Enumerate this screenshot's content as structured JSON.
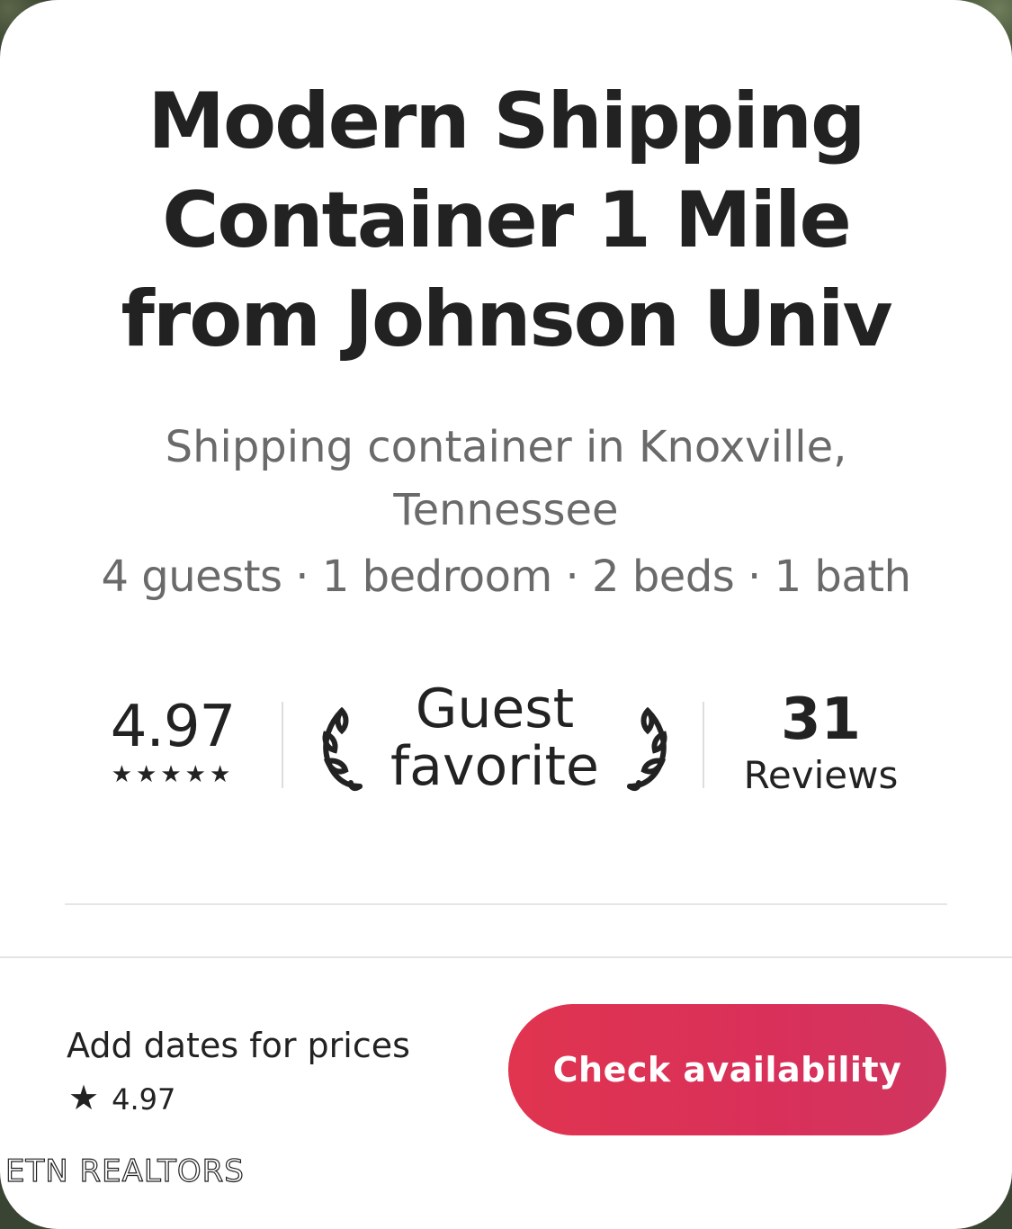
{
  "listing": {
    "title": "Modern Shipping Container 1 Mile from Johnson Univ",
    "subtitle": "Shipping container in Knoxville, Tennessee",
    "details": "4 guests · 1 bedroom · 2 beds · 1 bath"
  },
  "stats": {
    "rating": "4.97",
    "stars": "★★★★★",
    "badge_line1": "Guest",
    "badge_line2": "favorite",
    "reviews_count": "31",
    "reviews_label": "Reviews"
  },
  "footer": {
    "price_label": "Add dates for prices",
    "rating_star": "★",
    "rating": "4.97",
    "cta_label": "Check availability"
  },
  "watermark": "ETN REALTORS",
  "colors": {
    "accent": "#DB3557",
    "text": "#222222",
    "muted": "#6A6A6A",
    "divider": "#DDDDDD"
  },
  "icons": [
    "laurel-left-icon",
    "laurel-right-icon",
    "star-icon"
  ]
}
